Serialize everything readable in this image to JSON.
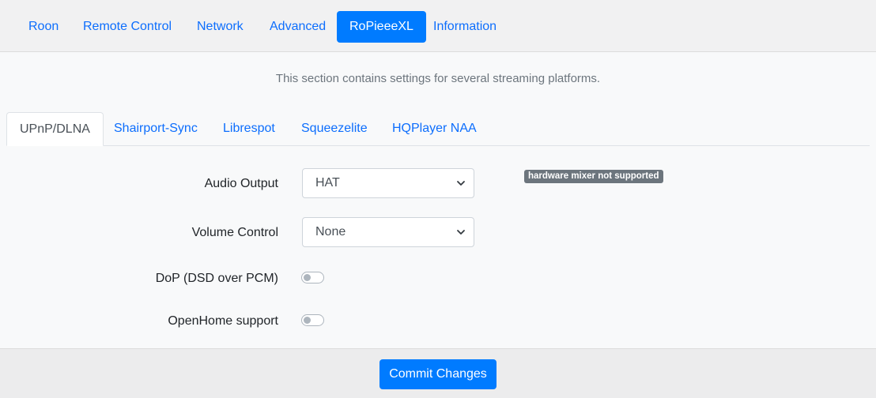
{
  "main_nav": {
    "items": [
      {
        "label": "Roon",
        "active": false
      },
      {
        "label": "Remote Control",
        "active": false
      },
      {
        "label": "Network",
        "active": false
      },
      {
        "label": "Advanced",
        "active": false
      },
      {
        "label": "RoPieeeXL",
        "active": true
      },
      {
        "label": "Information",
        "active": false
      }
    ]
  },
  "section": {
    "description": "This section contains settings for several streaming platforms."
  },
  "sub_tabs": {
    "items": [
      {
        "label": "UPnP/DLNA",
        "active": true
      },
      {
        "label": "Shairport-Sync",
        "active": false
      },
      {
        "label": "Librespot",
        "active": false
      },
      {
        "label": "Squeezelite",
        "active": false
      },
      {
        "label": "HQPlayer NAA",
        "active": false
      }
    ]
  },
  "form": {
    "audio_output": {
      "label": "Audio Output",
      "value": "HAT",
      "badge": "hardware mixer not supported"
    },
    "volume_control": {
      "label": "Volume Control",
      "value": "None"
    },
    "dop": {
      "label": "DoP (DSD over PCM)",
      "enabled": false
    },
    "openhome": {
      "label": "OpenHome support",
      "enabled": false
    }
  },
  "footer": {
    "commit_label": "Commit Changes"
  },
  "colors": {
    "accent": "#007bff",
    "link": "#0d6efd",
    "badge": "#6c757d"
  }
}
